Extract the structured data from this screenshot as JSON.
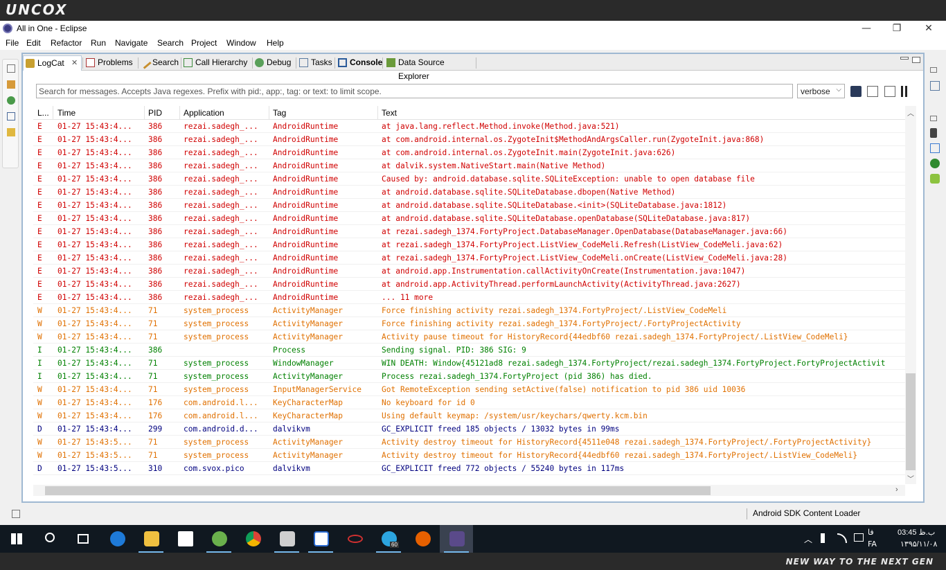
{
  "banner": {
    "logo": "UNCOX",
    "slogan": "NEW WAY TO THE NEXT GEN"
  },
  "window": {
    "title": "All in One - Eclipse",
    "minimize": "—",
    "maximize": "❐",
    "close": "✕"
  },
  "menu": [
    "File",
    "Edit",
    "Refactor",
    "Run",
    "Navigate",
    "Search",
    "Project",
    "Window",
    "Help"
  ],
  "tabs": [
    {
      "label": "LogCat",
      "active": true
    },
    {
      "label": "Problems"
    },
    {
      "label": "Search"
    },
    {
      "label": "Call Hierarchy"
    },
    {
      "label": "Debug"
    },
    {
      "label": "Tasks"
    },
    {
      "label": "Console"
    },
    {
      "label": "Data Source Explorer"
    }
  ],
  "tab_close_glyph": "✕",
  "logcat": {
    "search_placeholder": "Search for messages. Accepts Java regexes. Prefix with pid:, app:, tag: or text: to limit scope.",
    "level": "verbose",
    "columns": [
      "L...",
      "Time",
      "PID",
      "Application",
      "Tag",
      "Text"
    ],
    "level_colors": {
      "E": "#d00000",
      "W": "#e07000",
      "I": "#008000",
      "D": "#00007f"
    },
    "rows": [
      [
        "E",
        "01-27 15:43:4...",
        "386",
        "rezai.sadegh_...",
        "AndroidRuntime",
        "at java.lang.reflect.Method.invoke(Method.java:521)"
      ],
      [
        "E",
        "01-27 15:43:4...",
        "386",
        "rezai.sadegh_...",
        "AndroidRuntime",
        "at com.android.internal.os.ZygoteInit$MethodAndArgsCaller.run(ZygoteInit.java:868)"
      ],
      [
        "E",
        "01-27 15:43:4...",
        "386",
        "rezai.sadegh_...",
        "AndroidRuntime",
        "at com.android.internal.os.ZygoteInit.main(ZygoteInit.java:626)"
      ],
      [
        "E",
        "01-27 15:43:4...",
        "386",
        "rezai.sadegh_...",
        "AndroidRuntime",
        "at dalvik.system.NativeStart.main(Native Method)"
      ],
      [
        "E",
        "01-27 15:43:4...",
        "386",
        "rezai.sadegh_...",
        "AndroidRuntime",
        "Caused by: android.database.sqlite.SQLiteException: unable to open database file"
      ],
      [
        "E",
        "01-27 15:43:4...",
        "386",
        "rezai.sadegh_...",
        "AndroidRuntime",
        "at android.database.sqlite.SQLiteDatabase.dbopen(Native Method)"
      ],
      [
        "E",
        "01-27 15:43:4...",
        "386",
        "rezai.sadegh_...",
        "AndroidRuntime",
        "at android.database.sqlite.SQLiteDatabase.<init>(SQLiteDatabase.java:1812)"
      ],
      [
        "E",
        "01-27 15:43:4...",
        "386",
        "rezai.sadegh_...",
        "AndroidRuntime",
        "at android.database.sqlite.SQLiteDatabase.openDatabase(SQLiteDatabase.java:817)"
      ],
      [
        "E",
        "01-27 15:43:4...",
        "386",
        "rezai.sadegh_...",
        "AndroidRuntime",
        "at rezai.sadegh_1374.FortyProject.DatabaseManager.OpenDatabase(DatabaseManager.java:66)"
      ],
      [
        "E",
        "01-27 15:43:4...",
        "386",
        "rezai.sadegh_...",
        "AndroidRuntime",
        "at rezai.sadegh_1374.FortyProject.ListView_CodeMeli.Refresh(ListView_CodeMeli.java:62)"
      ],
      [
        "E",
        "01-27 15:43:4...",
        "386",
        "rezai.sadegh_...",
        "AndroidRuntime",
        "at rezai.sadegh_1374.FortyProject.ListView_CodeMeli.onCreate(ListView_CodeMeli.java:28)"
      ],
      [
        "E",
        "01-27 15:43:4...",
        "386",
        "rezai.sadegh_...",
        "AndroidRuntime",
        "at android.app.Instrumentation.callActivityOnCreate(Instrumentation.java:1047)"
      ],
      [
        "E",
        "01-27 15:43:4...",
        "386",
        "rezai.sadegh_...",
        "AndroidRuntime",
        "at android.app.ActivityThread.performLaunchActivity(ActivityThread.java:2627)"
      ],
      [
        "E",
        "01-27 15:43:4...",
        "386",
        "rezai.sadegh_...",
        "AndroidRuntime",
        "... 11 more"
      ],
      [
        "W",
        "01-27 15:43:4...",
        "71",
        "system_process",
        "ActivityManager",
        "  Force finishing activity rezai.sadegh_1374.FortyProject/.ListView_CodeMeli"
      ],
      [
        "W",
        "01-27 15:43:4...",
        "71",
        "system_process",
        "ActivityManager",
        "  Force finishing activity rezai.sadegh_1374.FortyProject/.FortyProjectActivity"
      ],
      [
        "W",
        "01-27 15:43:4...",
        "71",
        "system_process",
        "ActivityManager",
        "Activity pause timeout for HistoryRecord{44edbf60 rezai.sadegh_1374.FortyProject/.ListView_CodeMeli}"
      ],
      [
        "I",
        "01-27 15:43:4...",
        "386",
        "",
        "Process",
        "Sending signal. PID: 386 SIG: 9"
      ],
      [
        "I",
        "01-27 15:43:4...",
        "71",
        "system_process",
        "WindowManager",
        "WIN DEATH: Window{45121ad8 rezai.sadegh_1374.FortyProject/rezai.sadegh_1374.FortyProject.FortyProjectActivit"
      ],
      [
        "I",
        "01-27 15:43:4...",
        "71",
        "system_process",
        "ActivityManager",
        "Process rezai.sadegh_1374.FortyProject (pid 386) has died."
      ],
      [
        "W",
        "01-27 15:43:4...",
        "71",
        "system_process",
        "InputManagerService",
        "Got RemoteException sending setActive(false) notification to pid 386 uid 10036"
      ],
      [
        "W",
        "01-27 15:43:4...",
        "176",
        "com.android.l...",
        "KeyCharacterMap",
        "No keyboard for id 0"
      ],
      [
        "W",
        "01-27 15:43:4...",
        "176",
        "com.android.l...",
        "KeyCharacterMap",
        "Using default keymap: /system/usr/keychars/qwerty.kcm.bin"
      ],
      [
        "D",
        "01-27 15:43:4...",
        "299",
        "com.android.d...",
        "dalvikvm",
        "GC_EXPLICIT freed 185 objects / 13032 bytes in 99ms"
      ],
      [
        "W",
        "01-27 15:43:5...",
        "71",
        "system_process",
        "ActivityManager",
        "Activity destroy timeout for HistoryRecord{4511e048 rezai.sadegh_1374.FortyProject/.FortyProjectActivity}"
      ],
      [
        "W",
        "01-27 15:43:5...",
        "71",
        "system_process",
        "ActivityManager",
        "Activity destroy timeout for HistoryRecord{44edbf60 rezai.sadegh_1374.FortyProject/.ListView_CodeMeli}"
      ],
      [
        "D",
        "01-27 15:43:5...",
        "310",
        "com.svox.pico",
        "dalvikvm",
        "GC_EXPLICIT freed 772 objects / 55240 bytes in 117ms"
      ]
    ]
  },
  "status": {
    "text": "Android SDK Content Loader"
  },
  "taskbar": {
    "apps": [
      "start-icon",
      "search-icon",
      "task-view-icon",
      "edge-icon",
      "file-explorer-icon",
      "store-icon",
      "android-studio-icon",
      "chrome-icon",
      "usb-icon",
      "outlook-icon",
      "app-icon",
      "telegram-icon",
      "firefox-icon",
      "eclipse-icon"
    ],
    "telegram_badge": "60",
    "lang_short": "FA",
    "lang_fa": "فا",
    "time": "03:45 ب.ظ",
    "date": "۱۳۹۵/۱۱/۰۸"
  }
}
